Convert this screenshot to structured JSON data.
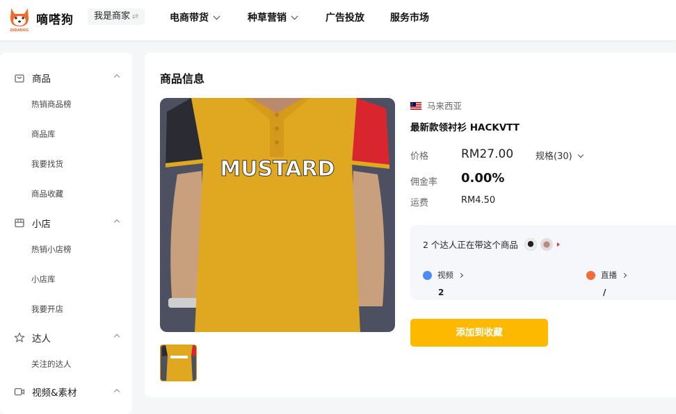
{
  "header": {
    "brand": "嘀嗒狗",
    "logo_text": "DIDADOG",
    "role_switch": "我是商家",
    "nav": [
      {
        "label": "电商带货",
        "has_dropdown": true
      },
      {
        "label": "种草营销",
        "has_dropdown": true
      },
      {
        "label": "广告投放",
        "has_dropdown": false
      },
      {
        "label": "服务市场",
        "has_dropdown": false
      }
    ]
  },
  "sidebar": {
    "sections": [
      {
        "label": "商品",
        "icon": "bag-icon",
        "items": [
          "热销商品榜",
          "商品库",
          "我要找货",
          "商品收藏"
        ]
      },
      {
        "label": "小店",
        "icon": "store-icon",
        "items": [
          "热销小店榜",
          "小店库",
          "我要开店"
        ]
      },
      {
        "label": "达人",
        "icon": "star-icon",
        "items": [
          "关注的达人"
        ]
      },
      {
        "label": "视频&素材",
        "icon": "video-icon",
        "items": []
      }
    ]
  },
  "product": {
    "section_title": "商品信息",
    "image_caption": "MUSTARD",
    "country": "马来西亚",
    "name": "最新款领衬衫 HACKVTT",
    "price_label": "价格",
    "price": "RM27.00",
    "spec": "规格(30)",
    "commission_label": "佣金率",
    "commission": "0.00%",
    "shipping_label": "运费",
    "shipping": "RM4.50"
  },
  "influencers": {
    "headline": "2 个达人正在带这个商品",
    "video_label": "视频",
    "video_count": "2",
    "live_label": "直播",
    "live_count": "/"
  },
  "actions": {
    "add_favorite": "添加到收藏"
  },
  "colors": {
    "accent": "#fcb900",
    "shirt": "#e0a820",
    "video_icon": "#4a8cf7",
    "live_icon": "#f26b3a"
  }
}
